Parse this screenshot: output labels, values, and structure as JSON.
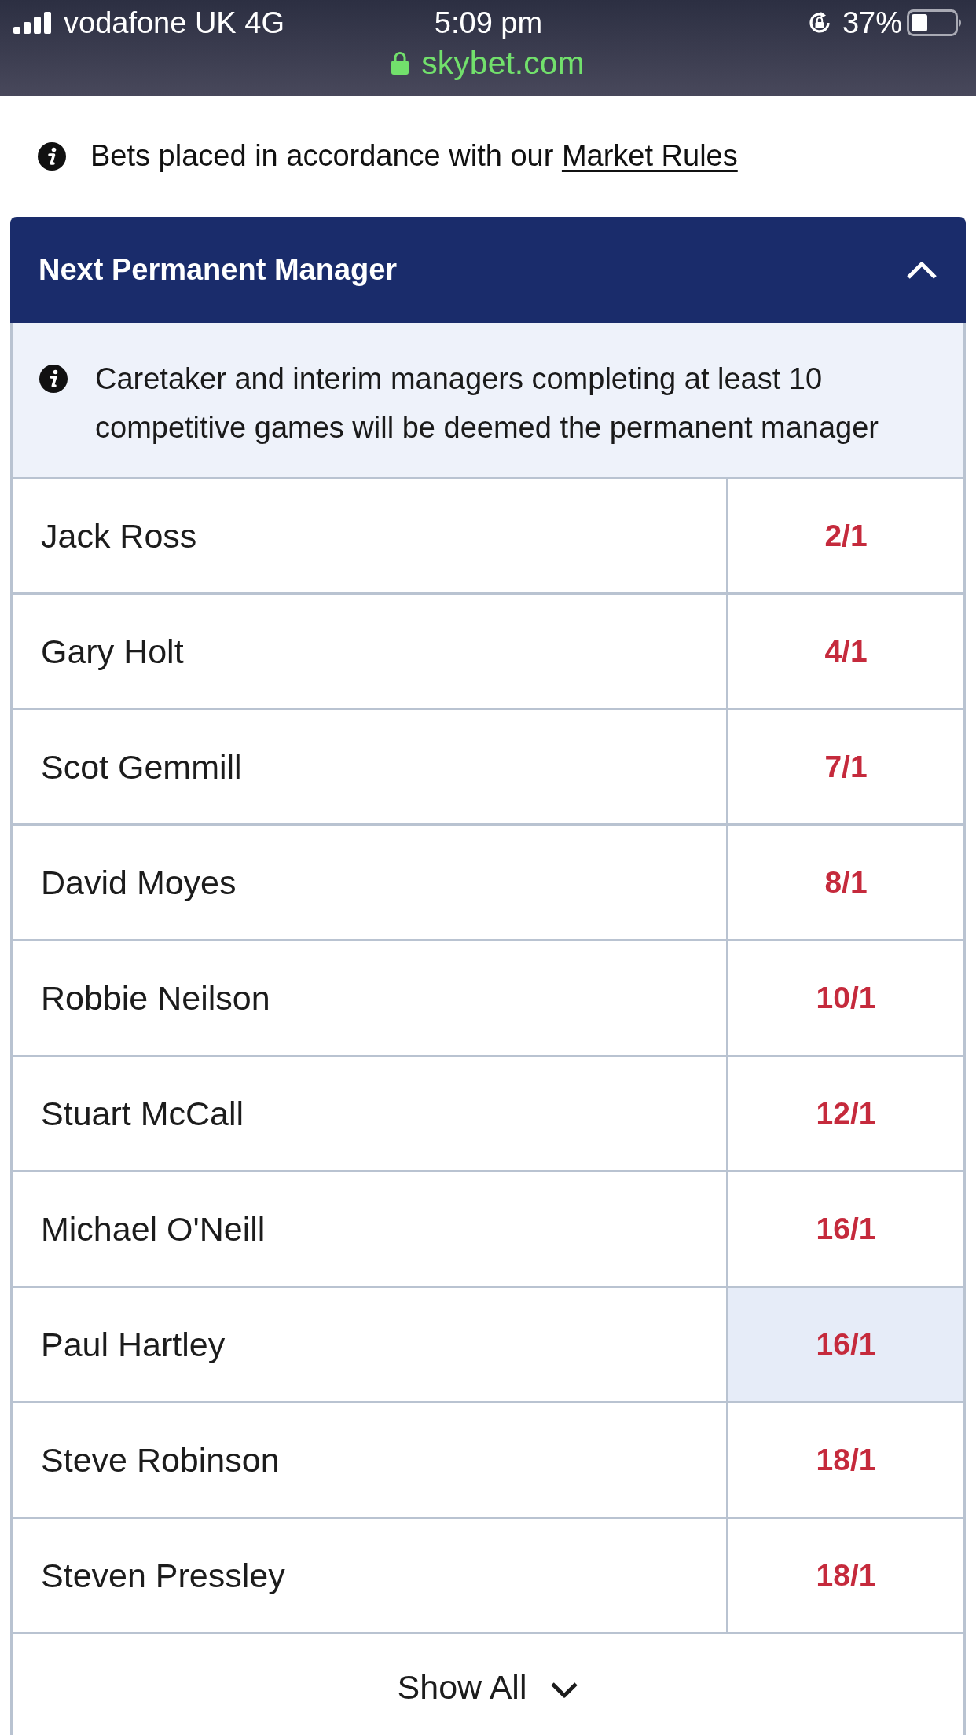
{
  "status_bar": {
    "carrier": "vodafone UK 4G",
    "time": "5:09 pm",
    "battery": "37%",
    "url": "skybet.com"
  },
  "info": {
    "text": "Bets placed in accordance with our",
    "link": "Market Rules"
  },
  "market": {
    "title": "Next Permanent Manager",
    "expanded": true,
    "notice": "Caretaker and interim managers completing at least 10 competitive games will be deemed the permanent manager",
    "selections": [
      {
        "name": "Jack Ross",
        "odds": "2/1",
        "selected": false
      },
      {
        "name": "Gary Holt",
        "odds": "4/1",
        "selected": false
      },
      {
        "name": "Scot Gemmill",
        "odds": "7/1",
        "selected": false
      },
      {
        "name": "David Moyes",
        "odds": "8/1",
        "selected": false
      },
      {
        "name": "Robbie Neilson",
        "odds": "10/1",
        "selected": false
      },
      {
        "name": "Stuart McCall",
        "odds": "12/1",
        "selected": false
      },
      {
        "name": "Michael O'Neill",
        "odds": "16/1",
        "selected": false
      },
      {
        "name": "Paul Hartley",
        "odds": "16/1",
        "selected": true
      },
      {
        "name": "Steve Robinson",
        "odds": "18/1",
        "selected": false
      },
      {
        "name": "Steven Pressley",
        "odds": "18/1",
        "selected": false
      }
    ],
    "show_all": "Show All"
  }
}
